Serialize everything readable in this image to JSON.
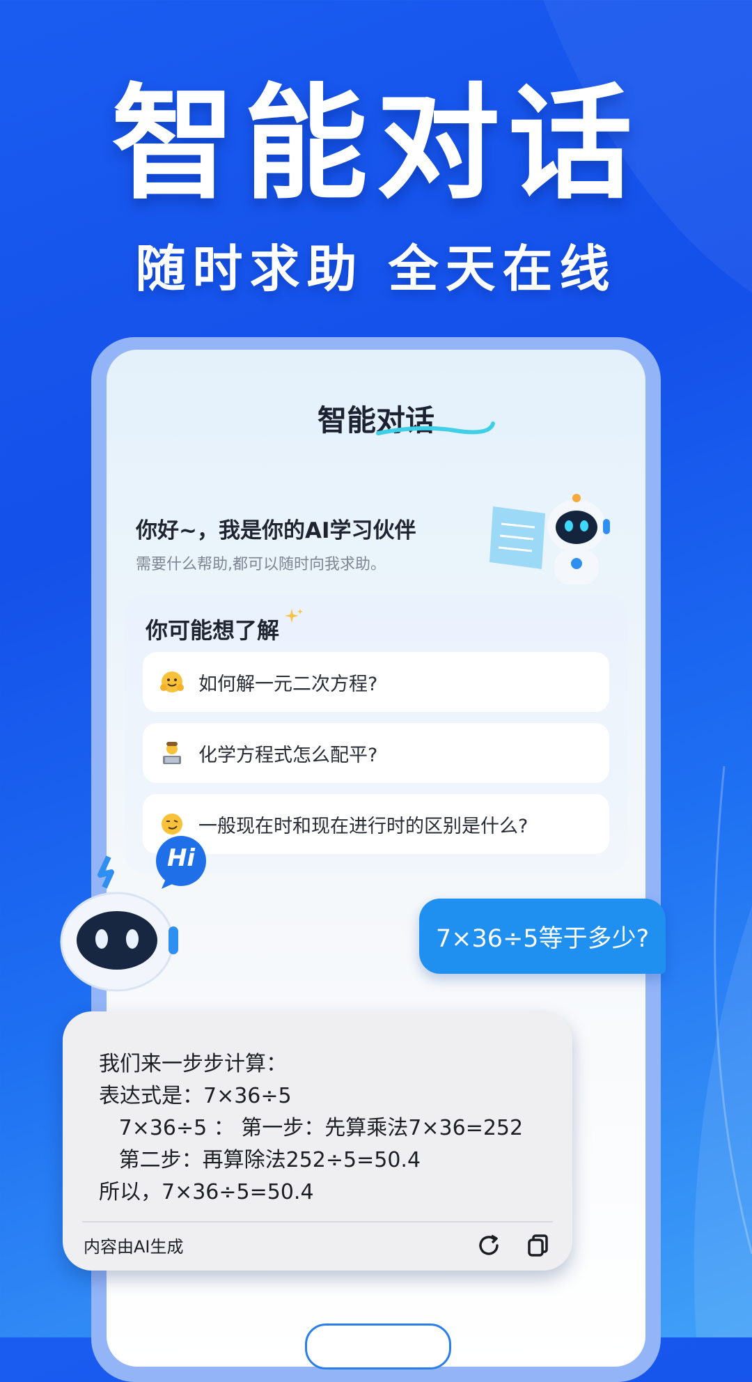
{
  "hero": {
    "title": "智能对话",
    "subtitle": "随时求助 全天在线"
  },
  "screen": {
    "title": "智能对话",
    "greeting": "你好~，我是你的AI学习伙伴",
    "greeting_sub": "需要什么帮助,都可以随时向我求助。",
    "suggest_heading": "你可能想了解",
    "suggestions": [
      {
        "emoji": "hug-face-icon",
        "text": "如何解一元二次方程?"
      },
      {
        "emoji": "technologist-icon",
        "text": "化学方程式怎么配平?"
      },
      {
        "emoji": "smirk-face-icon",
        "text": "一般现在时和现在进行时的区别是什么?"
      }
    ]
  },
  "chat": {
    "bot_greeting": "Hi",
    "user_message": "7×36÷5等于多少?",
    "ai_lines": [
      "我们来一步步计算：",
      "表达式是：7×36÷5",
      "   7×36÷5 ： 第一步：先算乘法7×36=252",
      "   第二步：再算除法252÷5=50.4",
      "所以，7×36÷5=50.4"
    ],
    "ai_footer": "内容由AI生成"
  },
  "colors": {
    "background": "#1a5cf0",
    "user_bubble": "#1f8ff0",
    "ai_bubble": "#efeff1",
    "phone_frame": "#93b4f7"
  }
}
